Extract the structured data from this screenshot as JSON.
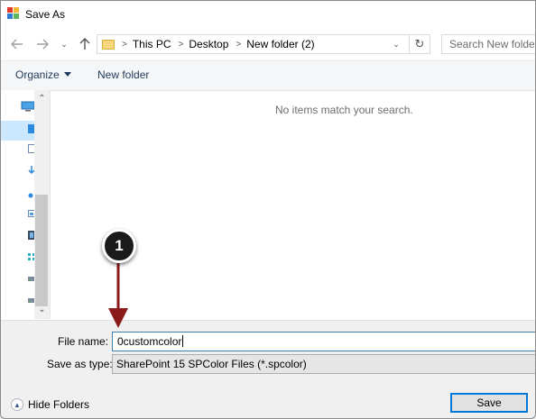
{
  "window": {
    "title": "Save As"
  },
  "nav": {
    "breadcrumbs": [
      "This PC",
      "Desktop",
      "New folder (2)"
    ],
    "search_placeholder": "Search New folder"
  },
  "toolbar": {
    "organize_label": "Organize",
    "new_folder_label": "New folder"
  },
  "content": {
    "empty_message": "No items match your search."
  },
  "form": {
    "file_name_label": "File name:",
    "file_name_value": "0customcolor",
    "save_type_label": "Save as type:",
    "save_type_value": "SharePoint 15 SPColor Files (*.spcolor)"
  },
  "footer": {
    "hide_folders_label": "Hide Folders",
    "save_label": "Save"
  },
  "annotation": {
    "step_number": "1"
  },
  "colors": {
    "accent": "#0078d7",
    "annotation_arrow": "#8b1a1a",
    "selection": "#cce8ff"
  }
}
